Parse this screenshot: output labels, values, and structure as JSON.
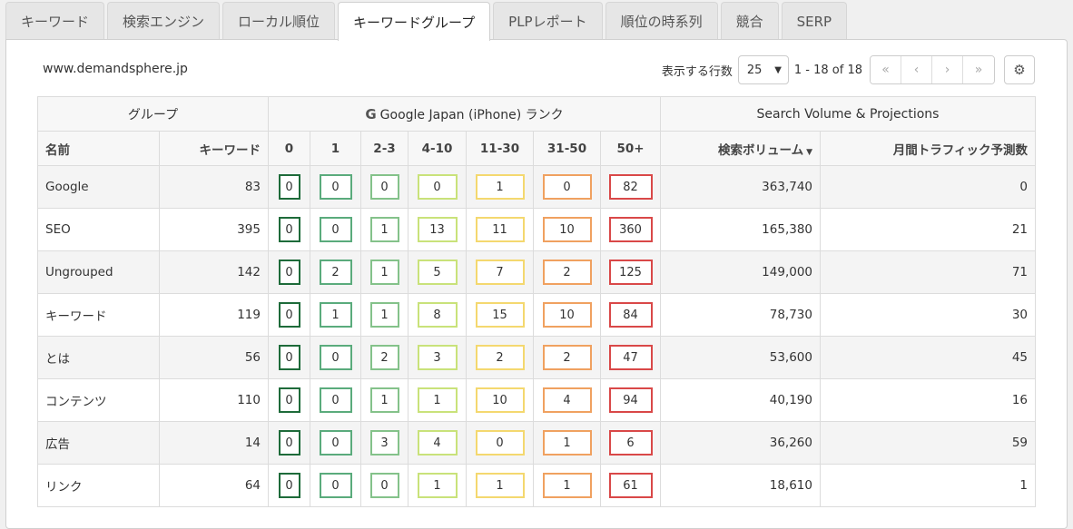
{
  "tabs": [
    "キーワード",
    "検索エンジン",
    "ローカル順位",
    "キーワードグループ",
    "PLPレポート",
    "順位の時系列",
    "競合",
    "SERP"
  ],
  "active_tab": 3,
  "site": "www.demandsphere.jp",
  "pager": {
    "rows_label": "表示する行数",
    "rows_value": "25",
    "range": "1 - 18 of 18",
    "first": "«",
    "prev": "‹",
    "next": "›",
    "last": "»"
  },
  "group_headers": {
    "group": "グループ",
    "google_icon": "G",
    "google": "Google Japan (iPhone) ランク",
    "volume": "Search Volume & Projections"
  },
  "columns": {
    "name": "名前",
    "keywords": "キーワード",
    "r0": "0",
    "r1": "1",
    "r2_3": "2-3",
    "r4_10": "4-10",
    "r11_30": "11-30",
    "r31_50": "31-50",
    "r50p": "50+",
    "volume": "検索ボリューム",
    "traffic": "月間トラフィック予測数"
  },
  "bucket_colors": [
    "#1e6b3a",
    "#5aab7c",
    "#84c28a",
    "#c9e27a",
    "#f4d86f",
    "#f0a160",
    "#d94848"
  ],
  "rows": [
    {
      "name": "Google",
      "keywords": "83",
      "b": [
        "0",
        "0",
        "0",
        "0",
        "1",
        "0",
        "82"
      ],
      "volume": "363,740",
      "traffic": "0"
    },
    {
      "name": "SEO",
      "keywords": "395",
      "b": [
        "0",
        "0",
        "1",
        "13",
        "11",
        "10",
        "360"
      ],
      "volume": "165,380",
      "traffic": "21"
    },
    {
      "name": "Ungrouped",
      "keywords": "142",
      "b": [
        "0",
        "2",
        "1",
        "5",
        "7",
        "2",
        "125"
      ],
      "volume": "149,000",
      "traffic": "71"
    },
    {
      "name": "キーワード",
      "keywords": "119",
      "b": [
        "0",
        "1",
        "1",
        "8",
        "15",
        "10",
        "84"
      ],
      "volume": "78,730",
      "traffic": "30"
    },
    {
      "name": "とは",
      "keywords": "56",
      "b": [
        "0",
        "0",
        "2",
        "3",
        "2",
        "2",
        "47"
      ],
      "volume": "53,600",
      "traffic": "45"
    },
    {
      "name": "コンテンツ",
      "keywords": "110",
      "b": [
        "0",
        "0",
        "1",
        "1",
        "10",
        "4",
        "94"
      ],
      "volume": "40,190",
      "traffic": "16"
    },
    {
      "name": "広告",
      "keywords": "14",
      "b": [
        "0",
        "0",
        "3",
        "4",
        "0",
        "1",
        "6"
      ],
      "volume": "36,260",
      "traffic": "59"
    },
    {
      "name": "リンク",
      "keywords": "64",
      "b": [
        "0",
        "0",
        "0",
        "1",
        "1",
        "1",
        "61"
      ],
      "volume": "18,610",
      "traffic": "1"
    }
  ]
}
